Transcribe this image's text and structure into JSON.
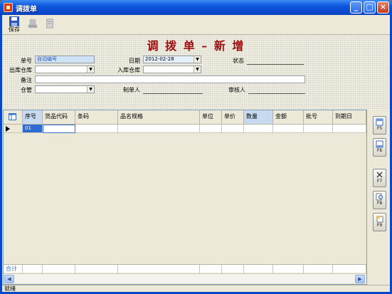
{
  "window": {
    "title": "调拨单"
  },
  "toolbar": {
    "save_label": "保存"
  },
  "form": {
    "heading": "调 拨 单 – 新 增",
    "order_no_label": "单号",
    "order_no_value": "自动编号",
    "date_label": "日期",
    "date_value": "2012-02-28",
    "status_label": "状态",
    "out_wh_label": "出库仓库",
    "in_wh_label": "入库仓库",
    "remark_label": "备注",
    "keeper_label": "仓管",
    "maker_label": "制单人",
    "auditor_label": "审核人"
  },
  "grid": {
    "columns": [
      "序号",
      "货品代码",
      "条码",
      "品名规格",
      "单位",
      "单价",
      "数量",
      "金额",
      "批号",
      "到期日"
    ],
    "rows": [
      {
        "seq": "01"
      }
    ],
    "total_label": "合计"
  },
  "sidebar": {
    "buttons": [
      "F5",
      "F6",
      "F7",
      "F8",
      "F9"
    ]
  },
  "status": {
    "text": "就绪"
  },
  "colors": {
    "heading": "#9c0c0c",
    "title_bar": "#0a47c8",
    "selected_cell": "#2e6ad2"
  }
}
